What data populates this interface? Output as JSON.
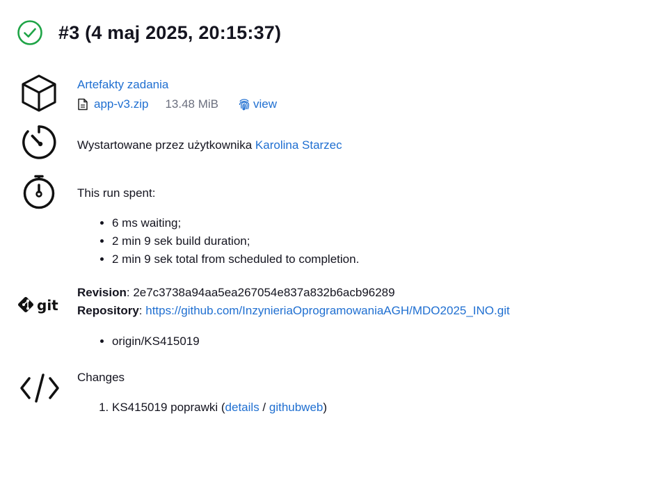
{
  "header": {
    "title": "#3 (4 maj 2025, 20:15:37)",
    "status_icon": "check-circle-icon",
    "status_color": "#1ea446"
  },
  "artifacts": {
    "icon": "package-icon",
    "title": "Artefakty zadania",
    "file_name": "app-v3.zip",
    "file_size": "13.48 MiB",
    "view_label": "view"
  },
  "started": {
    "icon": "gauge-icon",
    "text": "Wystartowane przez użytkownika",
    "user": "Karolina Starzec"
  },
  "timing": {
    "icon": "stopwatch-icon",
    "heading": "This run spent:",
    "items": [
      "6 ms waiting;",
      "2 min 9 sek build duration;",
      "2 min 9 sek total from scheduled to completion."
    ]
  },
  "git": {
    "icon": "git-logo",
    "revision_label": "Revision",
    "revision": "2e7c3738a94aa5ea267054e837a832b6acb96289",
    "repository_label": "Repository",
    "repository": "https://github.com/InzynieriaOprogramowaniaAGH/MDO2025_INO.git",
    "branches": [
      "origin/KS415019"
    ]
  },
  "changes": {
    "icon": "code-icon",
    "heading": "Changes",
    "items": [
      {
        "text": "KS415019 poprawki (",
        "details": "details",
        "sep": " / ",
        "githubweb": "githubweb",
        "end": ")"
      }
    ]
  },
  "colors": {
    "link": "#1f6fd1",
    "text": "#14141f",
    "muted": "#6b6f7e",
    "success": "#1ea446"
  }
}
